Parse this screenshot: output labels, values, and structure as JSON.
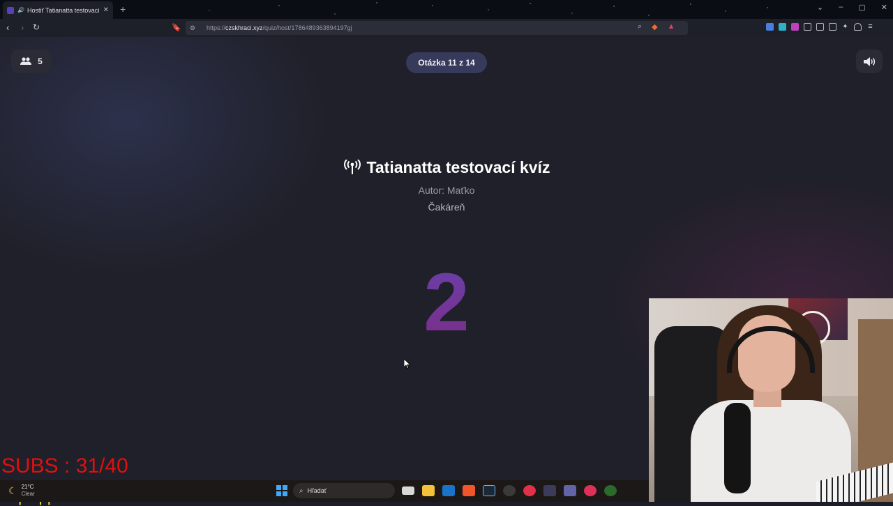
{
  "browser": {
    "tab_title": "Hostiť Tatianatta testovací k",
    "url_prefix": "https://",
    "url_domain": "czskhraci.xyz",
    "url_path": "/quiz/host/1786489363894197gj"
  },
  "header": {
    "player_count": "5",
    "question_progress": "Otázka 11 z 14"
  },
  "quiz": {
    "title": "Tatianatta testovací kvíz",
    "author": "Autor: Maťko",
    "status": "Čakáreň",
    "countdown": "2"
  },
  "overlay": {
    "subs": "SUBS : 31/40",
    "top_tipper": "Top tipper: No Data"
  },
  "taskbar": {
    "temperature": "21°C",
    "weather": "Clear",
    "search_placeholder": "Hľadať"
  },
  "colors": {
    "accent_pill": "#373a5a",
    "countdown_start": "#6a3fa8",
    "countdown_end": "#7a2f8a",
    "subs_red": "#e01010",
    "tipper_yellow": "#f0d63a"
  }
}
